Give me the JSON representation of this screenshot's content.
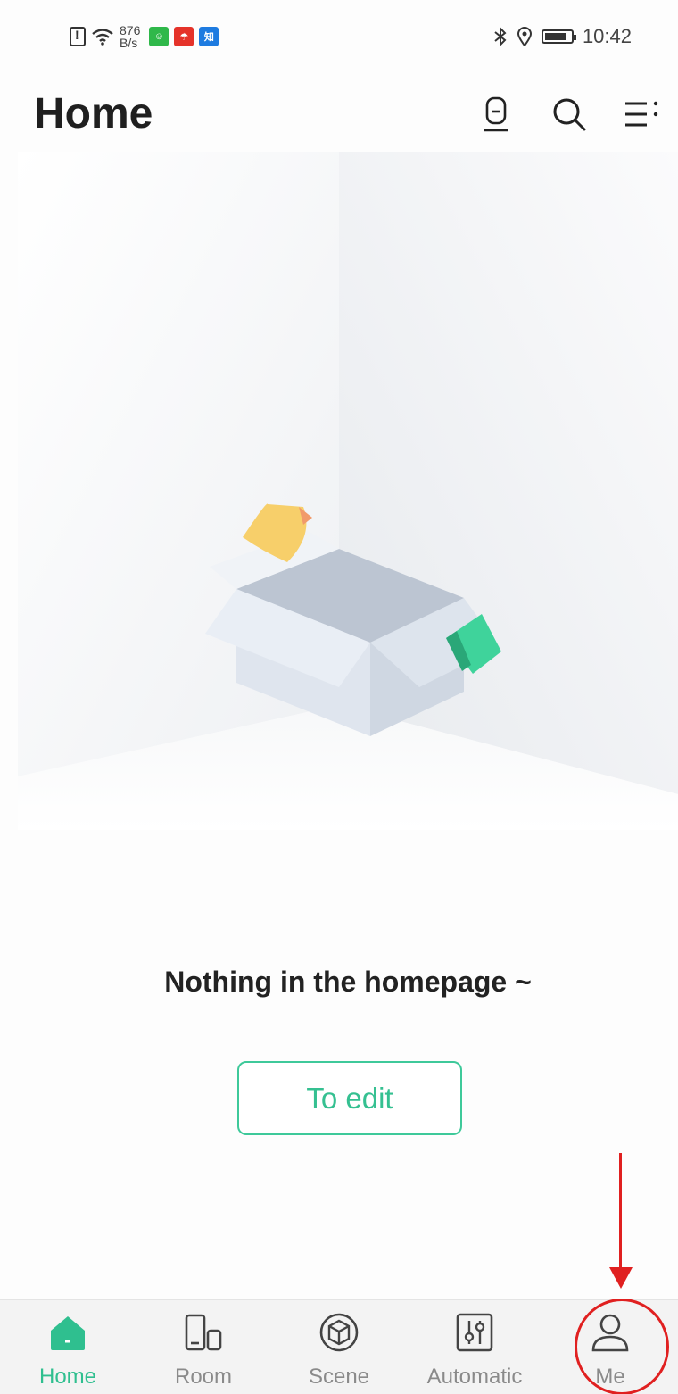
{
  "status_bar": {
    "net_speed_value": "876",
    "net_speed_unit": "B/s",
    "time": "10:42",
    "app_badges": [
      {
        "name": "wechat-badge",
        "color": "#2fb84a",
        "glyph": "☺"
      },
      {
        "name": "umbrella-badge",
        "color": "#e5332a",
        "glyph": "☂"
      },
      {
        "name": "zhihu-badge",
        "color": "#1e7be0",
        "glyph": "知"
      }
    ]
  },
  "header": {
    "title": "Home",
    "actions": [
      "device-icon",
      "search-icon",
      "menu-icon"
    ]
  },
  "empty_state": {
    "message": "Nothing in the homepage  ~",
    "button_label": "To edit"
  },
  "bottom_nav": {
    "items": [
      {
        "label": "Home",
        "icon": "home-icon",
        "active": true
      },
      {
        "label": "Room",
        "icon": "room-icon",
        "active": false
      },
      {
        "label": "Scene",
        "icon": "scene-icon",
        "active": false
      },
      {
        "label": "Automatic",
        "icon": "automatic-icon",
        "active": false
      },
      {
        "label": "Me",
        "icon": "me-icon",
        "active": false
      }
    ]
  },
  "colors": {
    "accent": "#35c091",
    "annotation": "#e02020"
  }
}
